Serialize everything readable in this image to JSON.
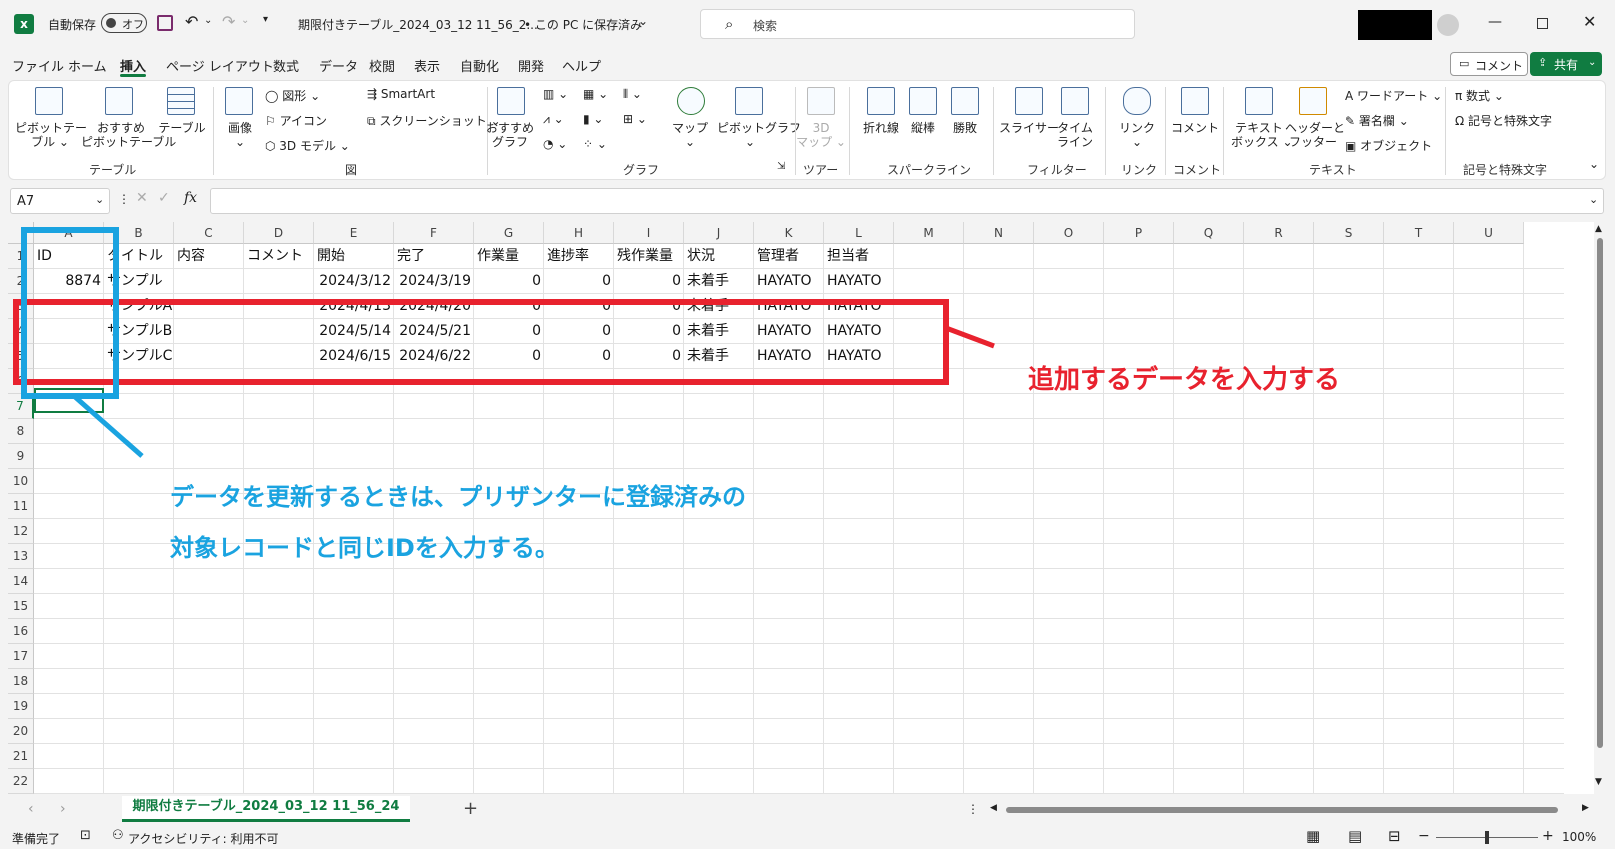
{
  "titlebar": {
    "autosave_label": "自動保存",
    "autosave_state": "オフ",
    "filename": "期限付きテーブル_2024_03_12 11_56_2...",
    "save_status": "• この PC に保存済み",
    "search_placeholder": "検索"
  },
  "menu": [
    "ファイル",
    "ホーム",
    "挿入",
    "ページ レイアウト",
    "数式",
    "データ",
    "校閲",
    "表示",
    "自動化",
    "開発",
    "ヘルプ"
  ],
  "menu_active": "挿入",
  "comment_button": "コメント",
  "share_button": "共有",
  "ribbon": {
    "pivot_table": "ピボットテー\nブル ⌄",
    "recommended_pivot": "おすすめ\nピボットテーブル",
    "table": "テーブル",
    "image": "画像\n⌄",
    "shapes": "図形 ⌄",
    "icons": "アイコン",
    "model3d": "3D モデル ⌄",
    "smartart": "SmartArt",
    "screenshot": "スクリーンショット ⌄",
    "rec_chart": "おすすめ\nグラフ",
    "map": "マップ\n⌄",
    "pivot_chart": "ピボットグラフ\n⌄",
    "map3d": "3D\nマップ ⌄",
    "line_spark": "折れ線",
    "column_spark": "縦棒",
    "winloss": "勝敗",
    "slicer": "スライサー",
    "timeline": "タイム\nライン",
    "link": "リンク\n⌄",
    "comment": "コメント",
    "textbox": "テキスト\nボックス ⌄",
    "header_footer": "ヘッダーと\nフッター",
    "wordart": "ワードアート ⌄",
    "signature": "署名欄 ⌄",
    "object": "オブジェクト",
    "equation": "数式 ⌄",
    "symbol": "記号と特殊文字",
    "groups": [
      "テーブル",
      "図",
      "グラフ",
      "ツアー",
      "スパークライン",
      "フィルター",
      "リンク",
      "コメント",
      "テキスト",
      "記号と特殊文字"
    ]
  },
  "namebox": "A7",
  "fx": "fx",
  "columns": [
    "A",
    "B",
    "C",
    "D",
    "E",
    "F",
    "G",
    "H",
    "I",
    "J",
    "K",
    "L",
    "M",
    "N",
    "O",
    "P",
    "Q",
    "R",
    "S",
    "T",
    "U"
  ],
  "rows": [
    "1",
    "2",
    "3",
    "4",
    "5",
    "6",
    "7",
    "8",
    "9",
    "10",
    "11",
    "12",
    "13",
    "14",
    "15",
    "16",
    "17",
    "18",
    "19",
    "20",
    "21",
    "22"
  ],
  "table": {
    "headers": [
      "ID",
      "タイトル",
      "内容",
      "コメント",
      "開始",
      "完了",
      "作業量",
      "進捗率",
      "残作業量",
      "状況",
      "管理者",
      "担当者"
    ],
    "rows": [
      [
        "8874",
        "サンプル",
        "",
        "",
        "2024/3/12",
        "2024/3/19",
        "0",
        "0",
        "0",
        "未着手",
        "HAYATO",
        "HAYATO"
      ],
      [
        "",
        "サンプルA",
        "",
        "",
        "2024/4/13",
        "2024/4/20",
        "0",
        "0",
        "0",
        "未着手",
        "HAYATO",
        "HAYATO"
      ],
      [
        "",
        "サンプルB",
        "",
        "",
        "2024/5/14",
        "2024/5/21",
        "0",
        "0",
        "0",
        "未着手",
        "HAYATO",
        "HAYATO"
      ],
      [
        "",
        "サンプルC",
        "",
        "",
        "2024/6/15",
        "2024/6/22",
        "0",
        "0",
        "0",
        "未着手",
        "HAYATO",
        "HAYATO"
      ]
    ]
  },
  "annotations": {
    "red_text": "追加するデータを入力する",
    "blue_line1": "データを更新するときは、プリザンターに登録済みの",
    "blue_line2": "対象レコードと同じIDを入力する。",
    "red_color": "#e8222e",
    "blue_color": "#1aa3e0"
  },
  "sheet_tab": "期限付きテーブル_2024_03_12 11_56_24",
  "add_sheet": "+",
  "status": {
    "ready": "準備完了",
    "accessibility": "アクセシビリティ: 利用不可",
    "zoom": "100%"
  },
  "colors": {
    "excel_green": "#107c41",
    "active_tab": "#107c41"
  }
}
